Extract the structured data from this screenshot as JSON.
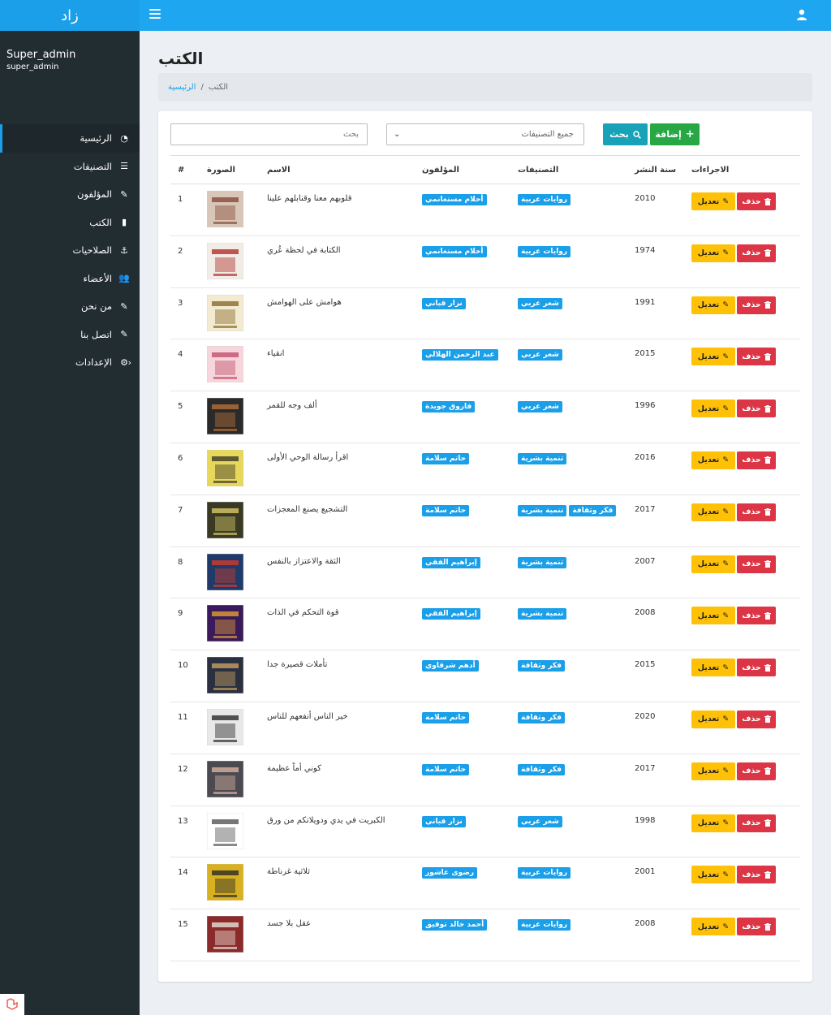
{
  "brand": "زاد",
  "user": {
    "name": "Super_admin",
    "role": "super_admin"
  },
  "sidebar": {
    "items": [
      {
        "label": "الرئيسية",
        "icon": "dashboard-icon",
        "active": true
      },
      {
        "label": "التصنيفات",
        "icon": "list-icon"
      },
      {
        "label": "المؤلفون",
        "icon": "pencil-icon"
      },
      {
        "label": "الكتب",
        "icon": "book-icon"
      },
      {
        "label": "الصلاحيات",
        "icon": "anchor-icon"
      },
      {
        "label": "الأعضاء",
        "icon": "users-icon"
      },
      {
        "label": "من نحن",
        "icon": "pencil-icon"
      },
      {
        "label": "اتصل بنا",
        "icon": "pencil-icon"
      },
      {
        "label": "الإعدادات",
        "icon": "gear-icon",
        "has_children": true
      }
    ]
  },
  "page": {
    "title": "الكتب"
  },
  "breadcrumb": {
    "home": "الرئيسية",
    "current": "الكتب"
  },
  "filters": {
    "search_placeholder": "بحث",
    "category_selected": "جميع التصنيفات",
    "search_button": "بحث",
    "add_button": "إضافة"
  },
  "table": {
    "headers": {
      "num": "#",
      "image": "الصورة",
      "name": "الاسم",
      "authors": "المؤلفون",
      "categories": "التصنيفات",
      "year": "سنة النشر",
      "actions": "الاجراءات"
    },
    "edit_label": "تعديل",
    "delete_label": "حذف",
    "rows": [
      {
        "num": "1",
        "name": "قلوبهم معنا وقنابلهم علينا",
        "author": "أحلام مستغانمي",
        "categories": [
          "روايات عربية"
        ],
        "year": "2010",
        "cover": [
          "#d8c7b8",
          "#8a4a3a"
        ]
      },
      {
        "num": "2",
        "name": "الكتابة في لحظة عُري",
        "author": "أحلام مستغانمي",
        "categories": [
          "روايات عربية"
        ],
        "year": "1974",
        "cover": [
          "#f2ece6",
          "#b0302a"
        ]
      },
      {
        "num": "3",
        "name": "هوامش على الهوامش",
        "author": "نزار قباني",
        "categories": [
          "شعر عربي"
        ],
        "year": "1991",
        "cover": [
          "#f3ead2",
          "#8a6a2a"
        ]
      },
      {
        "num": "4",
        "name": "انقياء",
        "author": "عبد الرحمن الهلالي",
        "categories": [
          "شعر عربي"
        ],
        "year": "2015",
        "cover": [
          "#f6d6dc",
          "#c2506a"
        ]
      },
      {
        "num": "5",
        "name": "ألف وجه للقمر",
        "author": "فاروق جويدة",
        "categories": [
          "شعر عربي"
        ],
        "year": "1996",
        "cover": [
          "#2a2a2a",
          "#b5703a"
        ]
      },
      {
        "num": "6",
        "name": "اقرأ رسالة الوحي الأولى",
        "author": "حاتم سلامة",
        "categories": [
          "تنمية بشرية"
        ],
        "year": "2016",
        "cover": [
          "#e8d85a",
          "#3a3a2a"
        ]
      },
      {
        "num": "7",
        "name": "التشجيع يصنع المعجزات",
        "author": "حاتم سلامة",
        "categories": [
          "تنمية بشرية",
          "فكر وثقافة"
        ],
        "year": "2017",
        "cover": [
          "#3a3a24",
          "#d8c868"
        ]
      },
      {
        "num": "8",
        "name": "الثقة والاعتزاز بالنفس",
        "author": "إبراهيم الفقي",
        "categories": [
          "تنمية بشرية"
        ],
        "year": "2007",
        "cover": [
          "#1f3b6a",
          "#d23a2a"
        ]
      },
      {
        "num": "9",
        "name": "قوة التحكم في الذات",
        "author": "إبراهيم الفقي",
        "categories": [
          "تنمية بشرية"
        ],
        "year": "2008",
        "cover": [
          "#3a1a5a",
          "#e0a030"
        ]
      },
      {
        "num": "10",
        "name": "تأملات قصيرة جدا",
        "author": "أدهم شرقاوي",
        "categories": [
          "فكر وثقافة"
        ],
        "year": "2015",
        "cover": [
          "#2a3040",
          "#c8a060"
        ]
      },
      {
        "num": "11",
        "name": "خير الناس أنفعهم للناس",
        "author": "حاتم سلامة",
        "categories": [
          "فكر وثقافة"
        ],
        "year": "2020",
        "cover": [
          "#e8e8e8",
          "#2a2a2a"
        ]
      },
      {
        "num": "12",
        "name": "كوني أماً عظيمة",
        "author": "حاتم سلامة",
        "categories": [
          "فكر وثقافة"
        ],
        "year": "2017",
        "cover": [
          "#4a4a50",
          "#d8b0a0"
        ]
      },
      {
        "num": "13",
        "name": "الكبريت في يدي ودويلاتكم من ورق",
        "author": "نزار قباني",
        "categories": [
          "شعر عربي"
        ],
        "year": "1998",
        "cover": [
          "#ffffff",
          "#555555"
        ]
      },
      {
        "num": "14",
        "name": "ثلاثية غرناطة",
        "author": "رضوى عاشور",
        "categories": [
          "روايات عربية"
        ],
        "year": "2001",
        "cover": [
          "#d8b020",
          "#2a2a2a"
        ]
      },
      {
        "num": "15",
        "name": "عقل بلا جسد",
        "author": "أحمد خالد توفيق",
        "categories": [
          "روايات عربية"
        ],
        "year": "2008",
        "cover": [
          "#8a2a2a",
          "#e8e0d8"
        ]
      }
    ]
  },
  "colors": {
    "primary": "#1a9fe8",
    "sidebar": "#222d32",
    "edit": "#ffc107",
    "delete": "#dc3545",
    "search": "#17a2b8",
    "add": "#28a745"
  }
}
